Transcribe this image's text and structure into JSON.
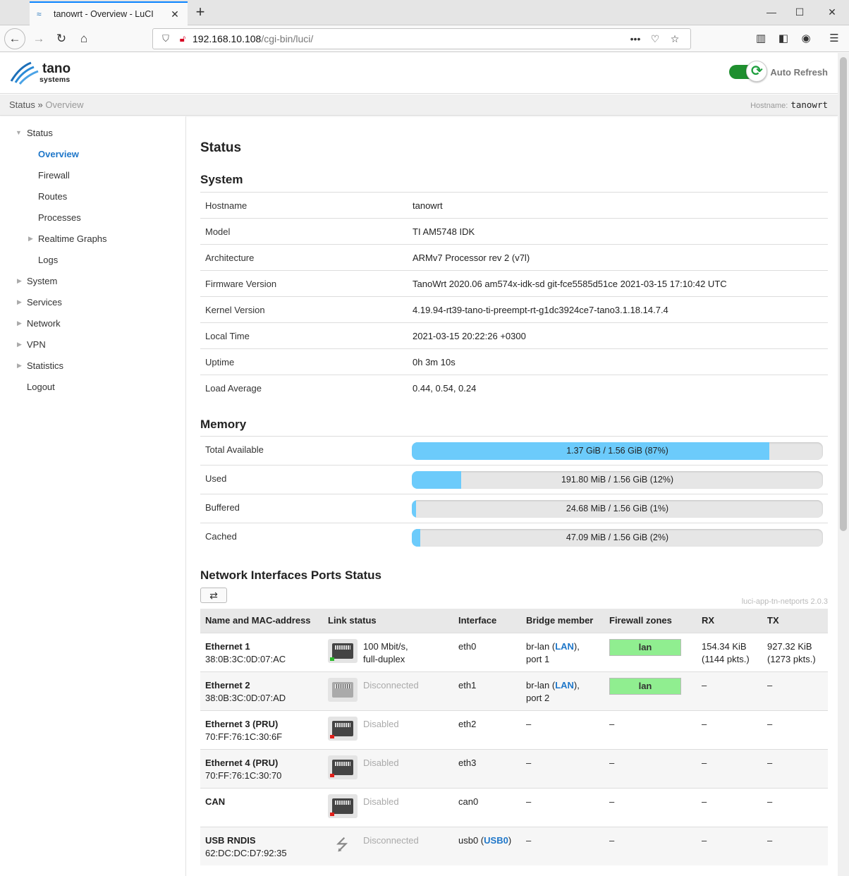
{
  "browser": {
    "tab_title": "tanowrt - Overview - LuCI",
    "url_host": "192.168.10.108",
    "url_path": "/cgi-bin/luci/"
  },
  "header": {
    "logo_line1": "tano",
    "logo_line2": "systems",
    "auto_refresh_label": "Auto Refresh"
  },
  "breadcrumb": {
    "parent": "Status",
    "sep": "»",
    "current": "Overview",
    "hostname_label": "Hostname:",
    "hostname_value": "tanowrt"
  },
  "sidebar": {
    "items": [
      {
        "label": "Status"
      },
      {
        "label": "Overview"
      },
      {
        "label": "Firewall"
      },
      {
        "label": "Routes"
      },
      {
        "label": "Processes"
      },
      {
        "label": "Realtime Graphs"
      },
      {
        "label": "Logs"
      },
      {
        "label": "System"
      },
      {
        "label": "Services"
      },
      {
        "label": "Network"
      },
      {
        "label": "VPN"
      },
      {
        "label": "Statistics"
      },
      {
        "label": "Logout"
      }
    ]
  },
  "main": {
    "title": "Status",
    "system": {
      "heading": "System",
      "rows": [
        {
          "key": "Hostname",
          "value": "tanowrt"
        },
        {
          "key": "Model",
          "value": "TI AM5748 IDK"
        },
        {
          "key": "Architecture",
          "value": "ARMv7 Processor rev 2 (v7l)"
        },
        {
          "key": "Firmware Version",
          "value": "TanoWrt 2020.06 am574x-idk-sd git-fce5585d51ce 2021-03-15 17:10:42 UTC"
        },
        {
          "key": "Kernel Version",
          "value": "4.19.94-rt39-tano-ti-preempt-rt-g1dc3924ce7-tano3.1.18.14.7.4"
        },
        {
          "key": "Local Time",
          "value": "2021-03-15 20:22:26 +0300"
        },
        {
          "key": "Uptime",
          "value": "0h 3m 10s"
        },
        {
          "key": "Load Average",
          "value": "0.44, 0.54, 0.24"
        }
      ]
    },
    "memory": {
      "heading": "Memory",
      "rows": [
        {
          "key": "Total Available",
          "text": "1.37 GiB / 1.56 GiB (87%)",
          "percent": 87
        },
        {
          "key": "Used",
          "text": "191.80 MiB / 1.56 GiB (12%)",
          "percent": 12
        },
        {
          "key": "Buffered",
          "text": "24.68 MiB / 1.56 GiB (1%)",
          "percent": 1
        },
        {
          "key": "Cached",
          "text": "47.09 MiB / 1.56 GiB (2%)",
          "percent": 2
        }
      ]
    },
    "ports": {
      "heading": "Network Interfaces Ports Status",
      "version": "luci-app-tn-netports 2.0.3",
      "columns": [
        "Name and MAC-address",
        "Link status",
        "Interface",
        "Bridge member",
        "Firewall zones",
        "RX",
        "TX"
      ],
      "rows": [
        {
          "name": "Ethernet 1",
          "mac": "38:0B:3C:0D:07:AC",
          "link1": "100 Mbit/s,",
          "link2": "full-duplex",
          "iface": "eth0",
          "bridge_pre": "br-lan (",
          "bridge_link": "LAN",
          "bridge_post": "),",
          "bridge_port": "port 1",
          "zone": "lan",
          "rx1": "154.34 KiB",
          "rx2": "(1144 pkts.)",
          "tx1": "927.32 KiB",
          "tx2": "(1273 pkts.)",
          "led": "#2db82d"
        },
        {
          "name": "Ethernet 2",
          "mac": "38:0B:3C:0D:07:AD",
          "link1": "Disconnected",
          "iface": "eth1",
          "bridge_pre": "br-lan (",
          "bridge_link": "LAN",
          "bridge_post": "),",
          "bridge_port": "port 2",
          "zone": "lan",
          "rx1": "–",
          "tx1": "–"
        },
        {
          "name": "Ethernet 3 (PRU)",
          "mac": "70:FF:76:1C:30:6F",
          "link1": "Disabled",
          "iface": "eth2",
          "bridge_pre": "–",
          "zone_dash": "–",
          "rx1": "–",
          "tx1": "–",
          "led": "#e0201b"
        },
        {
          "name": "Ethernet 4 (PRU)",
          "mac": "70:FF:76:1C:30:70",
          "link1": "Disabled",
          "iface": "eth3",
          "bridge_pre": "–",
          "zone_dash": "–",
          "rx1": "–",
          "tx1": "–",
          "led": "#e0201b"
        },
        {
          "name": "CAN",
          "mac": "",
          "link1": "Disabled",
          "iface": "can0",
          "bridge_pre": "–",
          "zone_dash": "–",
          "rx1": "–",
          "tx1": "–",
          "led": "#e0201b"
        },
        {
          "name": "USB RNDIS",
          "mac": "62:DC:DC:D7:92:35",
          "link1": "Disconnected",
          "iface_pre": "usb0 (",
          "iface_link": "USB0",
          "iface_post": ")",
          "bridge_pre": "–",
          "zone_dash": "–",
          "rx1": "–",
          "tx1": "–"
        }
      ]
    }
  }
}
